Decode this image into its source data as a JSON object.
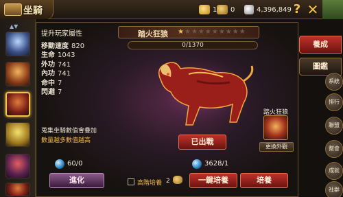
{
  "header": {
    "title": "坐騎",
    "ingot_count": "1",
    "coin_count": "0",
    "silver_amount": "4,396,849",
    "help_icon": "question-icon",
    "close_icon": "close-icon"
  },
  "stats": {
    "header": "提升玩家屬性",
    "rows": [
      {
        "label": "移動速度",
        "value": "820"
      },
      {
        "label": "生命",
        "value": "1043"
      },
      {
        "label": "外功",
        "value": "741"
      },
      {
        "label": "內功",
        "value": "741"
      },
      {
        "label": "命中",
        "value": "7"
      },
      {
        "label": "閃避",
        "value": "7"
      }
    ],
    "note_line1": "蒐集坐騎數值會疊加",
    "note_line2": "數量越多數值越高"
  },
  "mount": {
    "name": "踏火狂狼",
    "stars_filled": 1,
    "stars_total": 10,
    "exp_text": "0/1370",
    "exp_fraction": 0.0,
    "ridden_label": "已出戰"
  },
  "outfit": {
    "name": "踏火狂狼",
    "change_label": "更換外觀"
  },
  "bottom": {
    "advance_value": "60/0",
    "advance_label": "進化",
    "cultivate_value": "3628/1",
    "advanced_cultivate_label": "高階培養",
    "advanced_cultivate_count": "2",
    "oneclick_label": "一鍵培養",
    "cultivate_label": "培養"
  },
  "tabs": [
    {
      "label": "養成",
      "active": true
    },
    {
      "label": "圖鑑",
      "active": false
    }
  ],
  "side_menu": [
    "系統",
    "排行",
    "聯盟",
    "幫會",
    "成就",
    "社群"
  ],
  "colors": {
    "accent_red": "#c0302a",
    "gold": "#f2c24a",
    "note_orange": "#f2b84a"
  }
}
